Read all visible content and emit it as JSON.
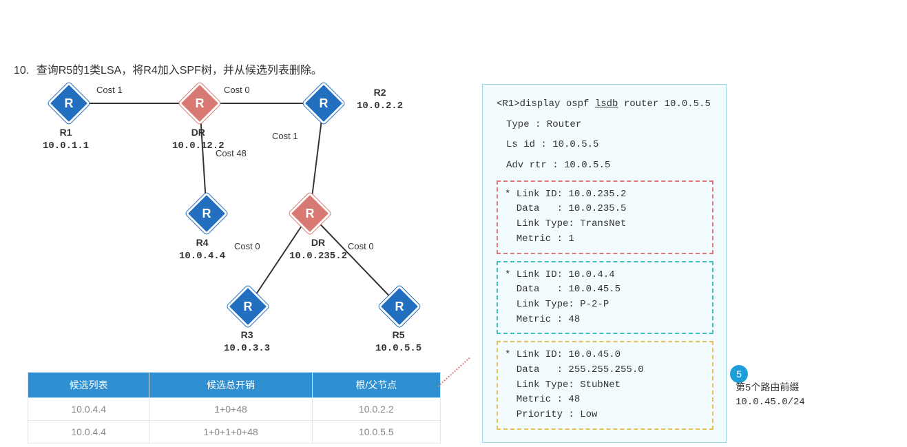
{
  "step": {
    "num": "10.",
    "text": "查询R5的1类LSA，将R4加入SPF树，并从候选列表删除。"
  },
  "nodes": {
    "r1": {
      "name": "R1",
      "ip": "10.0.1.1"
    },
    "dr12": {
      "name": "DR",
      "ip": "10.0.12.2"
    },
    "r2": {
      "name": "R2",
      "ip": "10.0.2.2"
    },
    "r4": {
      "name": "R4",
      "ip": "10.0.4.4"
    },
    "dr235": {
      "name": "DR",
      "ip": "10.0.235.2"
    },
    "r3": {
      "name": "R3",
      "ip": "10.0.3.3"
    },
    "r5": {
      "name": "R5",
      "ip": "10.0.5.5"
    }
  },
  "costs": {
    "r1_dr12": "Cost 1",
    "dr12_r2": "Cost 0",
    "r2_dr235": "Cost 1",
    "dr12_r4": "Cost 48",
    "dr235_r3": "Cost 0",
    "dr235_r5": "Cost 0"
  },
  "table": {
    "headers": [
      "候选列表",
      "候选总开销",
      "根/父节点"
    ],
    "rows": [
      [
        "10.0.4.4",
        "1+0+48",
        "10.0.2.2"
      ],
      [
        "10.0.4.4",
        "1+0+1+0+48",
        "10.0.5.5"
      ]
    ]
  },
  "cli": {
    "prompt": "<R1>display ospf ",
    "cmd_u": "lsdb",
    "cmd_rest": " router 10.0.5.5",
    "type_line": "Type      : Router",
    "lsid_line": "Ls id     : 10.0.5.5",
    "adv_label": "Adv ",
    "adv_u": "rtr",
    "adv_rest": "   : 10.0.5.5",
    "link1": {
      "l": "* Link ID: 10.0.235.2",
      "d": "  Data   : 10.0.235.5",
      "t": "  Link Type: TransNet",
      "m": "  Metric : 1"
    },
    "link2": {
      "l": "* Link ID: 10.0.4.4",
      "d": "  Data   : 10.0.45.5",
      "t": "  Link Type: P-2-P",
      "m": "  Metric : 48"
    },
    "link3": {
      "l": "* Link ID: 10.0.45.0",
      "d": "  Data   : 255.255.255.0",
      "t": "  Link Type: StubNet",
      "m": "  Metric : 48",
      "p": "  Priority : Low"
    }
  },
  "badge": {
    "num": "5",
    "line1": "第5个路由前缀",
    "line2": "10.0.45.0/24"
  },
  "glyph": "R"
}
